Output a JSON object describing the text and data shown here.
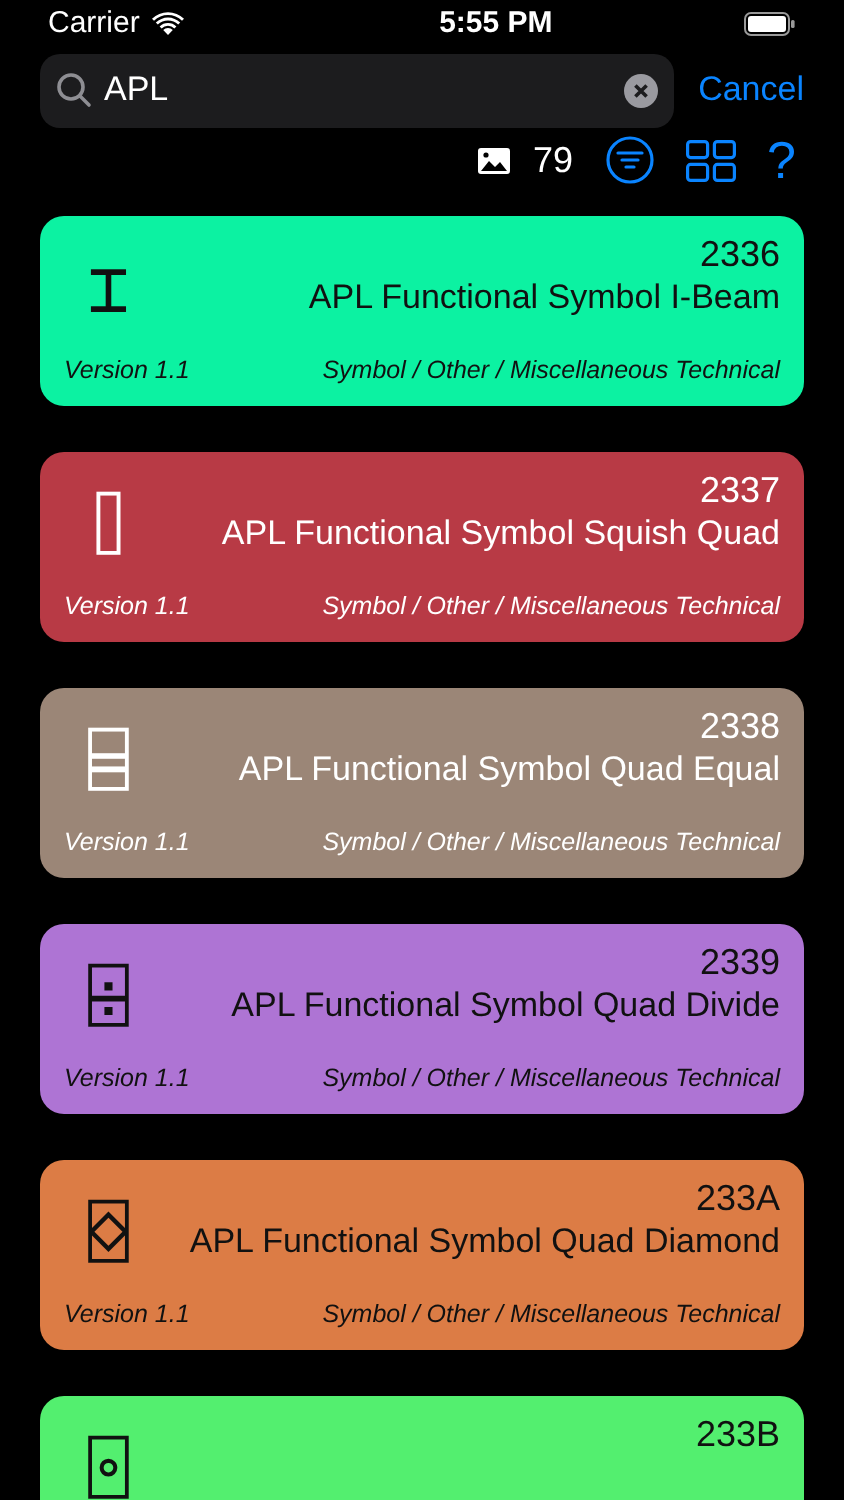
{
  "status_bar": {
    "carrier": "Carrier",
    "time": "5:55 PM"
  },
  "search": {
    "value": "APL",
    "cancel": "Cancel"
  },
  "toolbar": {
    "count": "79",
    "help": "?"
  },
  "cards": [
    {
      "glyph": "⌶",
      "code": "2336",
      "name": "APL Functional Symbol I-Beam",
      "version": "Version 1.1",
      "category": "Symbol / Other / Miscellaneous Technical",
      "color": "#0cf2a2",
      "light_text": false
    },
    {
      "glyph": "⌷",
      "code": "2337",
      "name": "APL Functional Symbol Squish Quad",
      "version": "Version 1.1",
      "category": "Symbol / Other / Miscellaneous Technical",
      "color": "#b83a45",
      "light_text": true
    },
    {
      "glyph": "⌸",
      "code": "2338",
      "name": "APL Functional Symbol Quad Equal",
      "version": "Version 1.1",
      "category": "Symbol / Other / Miscellaneous Technical",
      "color": "#9b8677",
      "light_text": true
    },
    {
      "glyph": "⌹",
      "code": "2339",
      "name": "APL Functional Symbol Quad Divide",
      "version": "Version 1.1",
      "category": "Symbol / Other / Miscellaneous Technical",
      "color": "#ae74d4",
      "light_text": false
    },
    {
      "glyph": "⌺",
      "code": "233A",
      "name": "APL Functional Symbol Quad Diamond",
      "version": "Version 1.1",
      "category": "Symbol / Other / Miscellaneous Technical",
      "color": "#dc7c45",
      "light_text": false
    },
    {
      "glyph": "⌻",
      "code": "233B",
      "color": "#53ef6f",
      "light_text": false
    }
  ]
}
